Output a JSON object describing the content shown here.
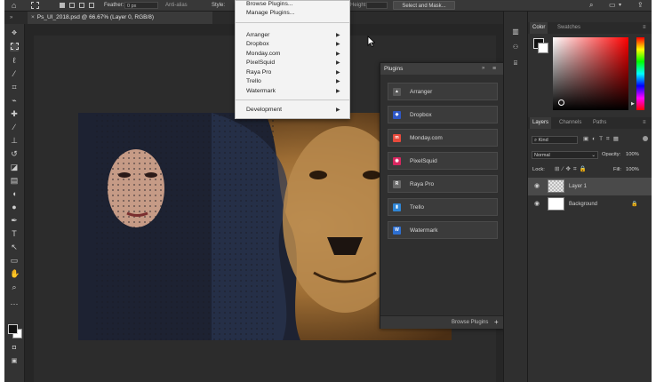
{
  "options_bar": {
    "feather_label": "Feather:",
    "feather_value": "0 px",
    "anti_alias_label": "Anti-alias",
    "style_label": "Style:",
    "height_label": "Height:",
    "select_mask_label": "Select and Mask..."
  },
  "document_tab": {
    "title": "Ps_UI_2018.psd @ 66.67% (Layer 0, RGB/8)"
  },
  "plugins_menu": {
    "top_items": [
      "Browse Plugins...",
      "Manage Plugins..."
    ],
    "submenu_items": [
      "Arranger",
      "Dropbox",
      "Monday.com",
      "PixelSquid",
      "Raya Pro",
      "Trello",
      "Watermark"
    ],
    "bottom_items": [
      "Development"
    ]
  },
  "plugins_panel": {
    "title": "Plugins",
    "items": [
      {
        "name": "Arranger",
        "icon": "arranger-icon",
        "color": "#5a5a5a",
        "glyph": "▲"
      },
      {
        "name": "Dropbox",
        "icon": "dropbox-icon",
        "color": "#2f58c7",
        "glyph": "◆"
      },
      {
        "name": "Monday.com",
        "icon": "monday-icon",
        "color": "#e84a3c",
        "glyph": "m"
      },
      {
        "name": "PixelSquid",
        "icon": "pixelsquid-icon",
        "color": "#d7265f",
        "glyph": "◉"
      },
      {
        "name": "Raya Pro",
        "icon": "raya-pro-icon",
        "color": "#6a6a6a",
        "glyph": "R"
      },
      {
        "name": "Trello",
        "icon": "trello-icon",
        "color": "#2f86d6",
        "glyph": "▮"
      },
      {
        "name": "Watermark",
        "icon": "watermark-icon",
        "color": "#2d6fd1",
        "glyph": "W"
      }
    ],
    "footer": "Browse Plugins"
  },
  "color_panel": {
    "tabs": [
      "Color",
      "Swatches"
    ]
  },
  "layers_panel": {
    "tabs": [
      "Layers",
      "Channels",
      "Paths"
    ],
    "kind_label": "Kind",
    "blend_mode": "Normal",
    "opacity_label": "Opacity:",
    "opacity_value": "100%",
    "lock_label": "Lock:",
    "fill_label": "Fill:",
    "fill_value": "100%",
    "layers": [
      {
        "name": "Layer 1",
        "selected": true
      },
      {
        "name": "Background",
        "selected": false
      }
    ]
  },
  "colors": {
    "accent": "#2d8ceb",
    "app_bg": "#262626",
    "panel_bg": "#303030",
    "menu_bg": "#f3f3f3"
  }
}
